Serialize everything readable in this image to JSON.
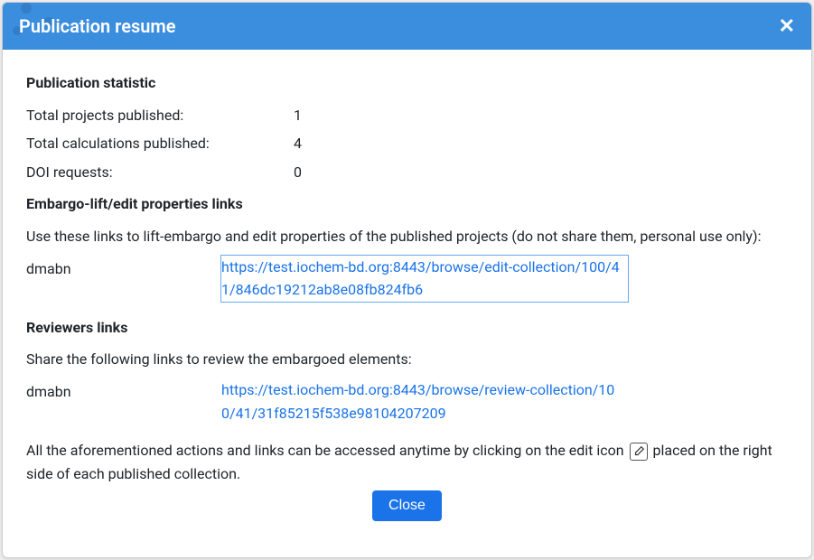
{
  "modal": {
    "title": "Publication resume",
    "close_label": "Close"
  },
  "stats": {
    "heading": "Publication statistic",
    "rows": [
      {
        "label": "Total projects published:",
        "value": "1"
      },
      {
        "label": "Total calculations published:",
        "value": "4"
      },
      {
        "label": "DOI requests:",
        "value": "0"
      }
    ]
  },
  "embargo": {
    "heading": "Embargo-lift/edit properties links",
    "instruction": "Use these links to lift-embargo and edit properties of the published projects (do not share them, personal use only):",
    "item": {
      "label": "dmabn",
      "url": "https://test.iochem-bd.org:8443/browse/edit-collection/100/41/846dc19212ab8e08fb824fb6"
    }
  },
  "reviewers": {
    "heading": "Reviewers links",
    "instruction": "Share the following links to review the embargoed elements:",
    "item": {
      "label": "dmabn",
      "url": "https://test.iochem-bd.org:8443/browse/review-collection/100/41/31f85215f538e98104207209"
    }
  },
  "footer_note": {
    "part1": "All the aforementioned actions and links can be accessed anytime by clicking on the edit icon ",
    "part2": " placed on the right side of each published collection."
  }
}
